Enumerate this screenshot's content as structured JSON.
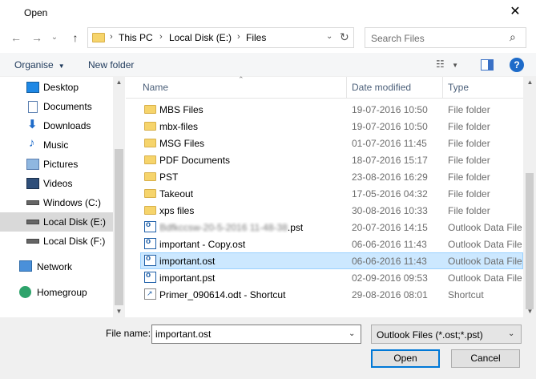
{
  "window": {
    "title": "Open",
    "close_glyph": "✕"
  },
  "nav": {
    "back_glyph": "←",
    "forward_glyph": "→",
    "recent_glyph": "⌄",
    "up_glyph": "↑",
    "breadcrumbs": [
      "This PC",
      "Local Disk (E:)",
      "Files"
    ],
    "search_placeholder": "Search Files"
  },
  "toolbar": {
    "organise": "Organise",
    "new_folder": "New folder"
  },
  "sidebar": {
    "items": [
      {
        "label": "Desktop",
        "icon": "desktop-icon"
      },
      {
        "label": "Documents",
        "icon": "documents-icon"
      },
      {
        "label": "Downloads",
        "icon": "downloads-icon"
      },
      {
        "label": "Music",
        "icon": "music-icon"
      },
      {
        "label": "Pictures",
        "icon": "pictures-icon"
      },
      {
        "label": "Videos",
        "icon": "videos-icon"
      },
      {
        "label": "Windows (C:)",
        "icon": "drive-icon"
      },
      {
        "label": "Local Disk (E:)",
        "icon": "drive-icon",
        "selected": true
      },
      {
        "label": "Local Disk (F:)",
        "icon": "drive-icon"
      },
      {
        "label": "Network",
        "icon": "network-icon"
      },
      {
        "label": "Homegroup",
        "icon": "homegroup-icon"
      }
    ]
  },
  "columns": {
    "name": "Name",
    "date": "Date modified",
    "type": "Type"
  },
  "files": [
    {
      "name": "MBS Files",
      "date": "19-07-2016 10:50",
      "type": "File folder",
      "icon": "folder-icon"
    },
    {
      "name": "mbx-files",
      "date": "19-07-2016 10:50",
      "type": "File folder",
      "icon": "folder-icon"
    },
    {
      "name": "MSG Files",
      "date": "01-07-2016 11:45",
      "type": "File folder",
      "icon": "folder-icon"
    },
    {
      "name": "PDF Documents",
      "date": "18-07-2016 15:17",
      "type": "File folder",
      "icon": "folder-icon"
    },
    {
      "name": "PST",
      "date": "23-08-2016 16:29",
      "type": "File folder",
      "icon": "folder-icon"
    },
    {
      "name": "Takeout",
      "date": "17-05-2016 04:32",
      "type": "File folder",
      "icon": "folder-icon"
    },
    {
      "name": "xps files",
      "date": "30-08-2016 10:33",
      "type": "File folder",
      "icon": "folder-icon"
    },
    {
      "name": ".pst",
      "blurred_prefix": "Bdfkccsw-20-5-2016 11-48-38",
      "date": "20-07-2016 14:15",
      "type": "Outlook Data File",
      "icon": "outlook-file-icon"
    },
    {
      "name": "important - Copy.ost",
      "date": "06-06-2016 11:43",
      "type": "Outlook Data File",
      "icon": "outlook-file-icon"
    },
    {
      "name": "important.ost",
      "date": "06-06-2016 11:43",
      "type": "Outlook Data File",
      "icon": "outlook-file-icon",
      "selected": true
    },
    {
      "name": "important.pst",
      "date": "02-09-2016 09:53",
      "type": "Outlook Data File",
      "icon": "outlook-file-icon"
    },
    {
      "name": "Primer_090614.odt - Shortcut",
      "date": "29-08-2016 08:01",
      "type": "Shortcut",
      "icon": "shortcut-icon"
    }
  ],
  "footer": {
    "file_name_label": "File name:",
    "file_name_value": "important.ost",
    "file_type_value": "Outlook Files (*.ost;*.pst)",
    "open_label": "Open",
    "cancel_label": "Cancel"
  },
  "colors": {
    "selection": "#cce8ff",
    "accent": "#0078d7",
    "folder": "#f6d46b"
  }
}
